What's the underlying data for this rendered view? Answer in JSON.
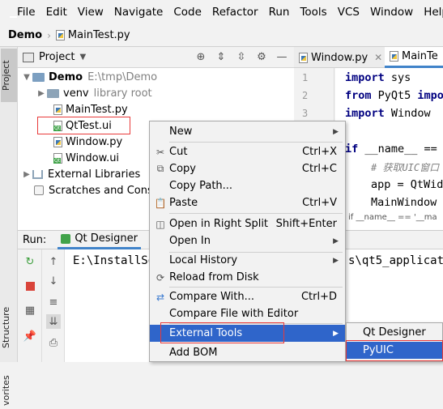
{
  "menubar": {
    "items": [
      "File",
      "Edit",
      "View",
      "Navigate",
      "Code",
      "Refactor",
      "Run",
      "Tools",
      "VCS",
      "Window",
      "Help"
    ]
  },
  "breadcrumb": {
    "project": "Demo",
    "file": "MainTest.py"
  },
  "left_stripe": {
    "project_tab": "Project",
    "structure_tab": "Structure",
    "favorites_tab": "vorites"
  },
  "project_panel": {
    "title": "Project",
    "tree": [
      {
        "label": "Demo",
        "hint": "E:\\tmp\\Demo"
      },
      {
        "label": "venv",
        "hint": "library root"
      },
      {
        "label": "MainTest.py"
      },
      {
        "label": "QtTest.ui"
      },
      {
        "label": "Window.py"
      },
      {
        "label": "Window.ui"
      },
      {
        "label": "External Libraries"
      },
      {
        "label": "Scratches and Conso"
      }
    ]
  },
  "editor": {
    "tabs": [
      "Window.py",
      "MainTe"
    ],
    "line_numbers": [
      "1",
      "2",
      "3"
    ],
    "lines": {
      "l1_kw": "import",
      "l1_rest": " sys",
      "l2_kw": "from",
      "l2_rest": " PyQt5 ",
      "l2_kw2": "impo",
      "l3_kw": "import",
      "l3_rest": " Window",
      "l5_kw": "if",
      "l5_rest": " __name__ == ",
      "l6": "# 获取UIC窗口",
      "l7": "app = QtWid",
      "l8": "MainWindow",
      "crumb": "if __name__ == '__ma"
    }
  },
  "run_panel": {
    "label": "Run:",
    "tab": "Qt Designer",
    "console_text": "E:\\InstallSo",
    "console_text_right": "s\\qt5_applicati"
  },
  "context_menu": {
    "items": [
      {
        "label": "New",
        "shortcut": ""
      },
      {
        "label": "Cut",
        "shortcut": "Ctrl+X"
      },
      {
        "label": "Copy",
        "shortcut": "Ctrl+C"
      },
      {
        "label": "Copy Path...",
        "shortcut": ""
      },
      {
        "label": "Paste",
        "shortcut": "Ctrl+V"
      },
      {
        "label": "Open in Right Split",
        "shortcut": "Shift+Enter"
      },
      {
        "label": "Open In",
        "shortcut": ""
      },
      {
        "label": "Local History",
        "shortcut": ""
      },
      {
        "label": "Reload from Disk",
        "shortcut": ""
      },
      {
        "label": "Compare With...",
        "shortcut": "Ctrl+D"
      },
      {
        "label": "Compare File with Editor",
        "shortcut": ""
      },
      {
        "label": "External Tools",
        "shortcut": ""
      },
      {
        "label": "Add BOM",
        "shortcut": ""
      }
    ]
  },
  "submenu": {
    "items": [
      "Qt Designer",
      "PyUIC"
    ]
  },
  "colors": {
    "highlight": "#2f65ca",
    "annotation_red": "#e83a3a",
    "keyword": "#000080",
    "active_tab": "#4083c9"
  }
}
